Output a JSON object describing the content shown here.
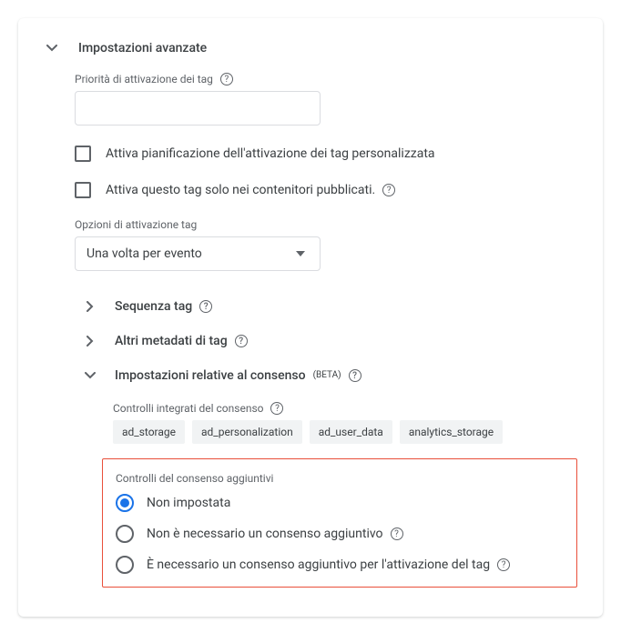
{
  "header": {
    "title": "Impostazioni avanzate"
  },
  "priority": {
    "label": "Priorità di attivazione dei tag",
    "value": ""
  },
  "checkbox1": {
    "label": "Attiva pianificazione dell'attivazione dei tag personalizzata"
  },
  "checkbox2": {
    "label": "Attiva questo tag solo nei contenitori pubblicati."
  },
  "firingOptions": {
    "label": "Opzioni di attivazione tag",
    "value": "Una volta per evento"
  },
  "seq": {
    "title": "Sequenza tag"
  },
  "meta": {
    "title": "Altri metadati di tag"
  },
  "consent": {
    "title": "Impostazioni relative al consenso",
    "badge": "(BETA)",
    "builtinLabel": "Controlli integrati del consenso",
    "chips": [
      "ad_storage",
      "ad_personalization",
      "ad_user_data",
      "analytics_storage"
    ],
    "additional": {
      "label": "Controlli del consenso aggiuntivi",
      "options": {
        "a": "Non impostata",
        "b": "Non è necessario un consenso aggiuntivo",
        "c": "È necessario un consenso aggiuntivo per l'attivazione del tag"
      }
    }
  }
}
